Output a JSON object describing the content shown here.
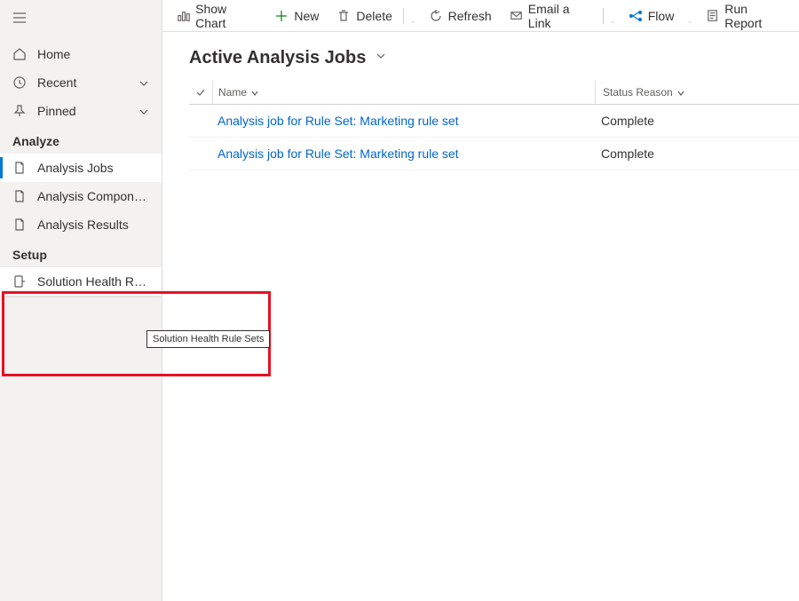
{
  "sidebar": {
    "top": [
      {
        "icon": "home",
        "label": "Home",
        "expandable": false
      },
      {
        "icon": "clock",
        "label": "Recent",
        "expandable": true
      },
      {
        "icon": "pin",
        "label": "Pinned",
        "expandable": true
      }
    ],
    "sections": [
      {
        "title": "Analyze",
        "items": [
          {
            "icon": "doc",
            "label": "Analysis Jobs",
            "selected": true
          },
          {
            "icon": "doc",
            "label": "Analysis Components",
            "selected": false
          },
          {
            "icon": "doc",
            "label": "Analysis Results",
            "selected": false
          }
        ]
      },
      {
        "title": "Setup",
        "items": [
          {
            "icon": "health",
            "label": "Solution Health Rule ...",
            "hovered": true
          }
        ]
      }
    ]
  },
  "tooltip": "Solution Health Rule Sets",
  "cmdbar": {
    "show_chart": "Show Chart",
    "new": "New",
    "delete": "Delete",
    "refresh": "Refresh",
    "email": "Email a Link",
    "flow": "Flow",
    "run_report": "Run Report"
  },
  "page_title": "Active Analysis Jobs",
  "grid": {
    "columns": {
      "name": "Name",
      "status": "Status Reason"
    },
    "rows": [
      {
        "name": "Analysis job for Rule Set: Marketing rule set",
        "status": "Complete"
      },
      {
        "name": "Analysis job for Rule Set: Marketing rule set",
        "status": "Complete"
      }
    ]
  }
}
